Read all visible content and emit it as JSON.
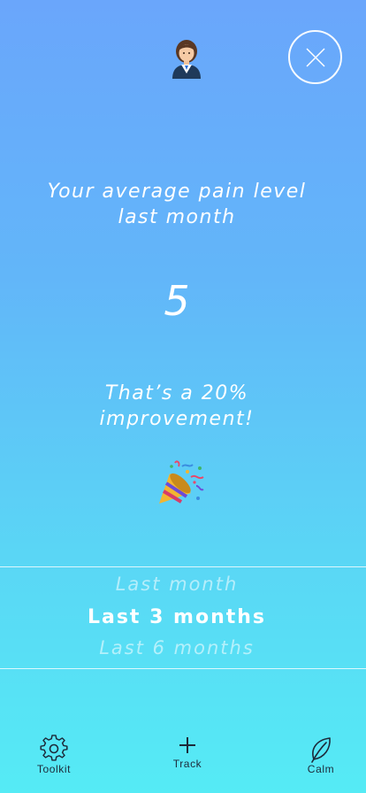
{
  "header": {
    "avatar_icon": "businesswoman-avatar-icon",
    "close_icon": "close-icon"
  },
  "stat": {
    "title_line1": "Your average pain level",
    "title_line2": "last month",
    "value": "5",
    "subtitle_line1": "That’s a 20%",
    "subtitle_line2": "improvement!",
    "celebration_icon": "party-popper-icon"
  },
  "picker": {
    "options": [
      "Last month",
      "Last 3 months",
      "Last 6 months"
    ],
    "selected": "Last 3 months"
  },
  "nav": {
    "items": [
      {
        "label": "Toolkit",
        "icon": "gear-icon"
      },
      {
        "label": "Track",
        "icon": "plus-icon"
      },
      {
        "label": "Calm",
        "icon": "leaf-icon"
      }
    ]
  },
  "colors": {
    "gradient_top": "#6aa6fb",
    "gradient_bottom": "#55ebf5",
    "text": "#ffffff",
    "nav_text": "#1d2a3a"
  }
}
